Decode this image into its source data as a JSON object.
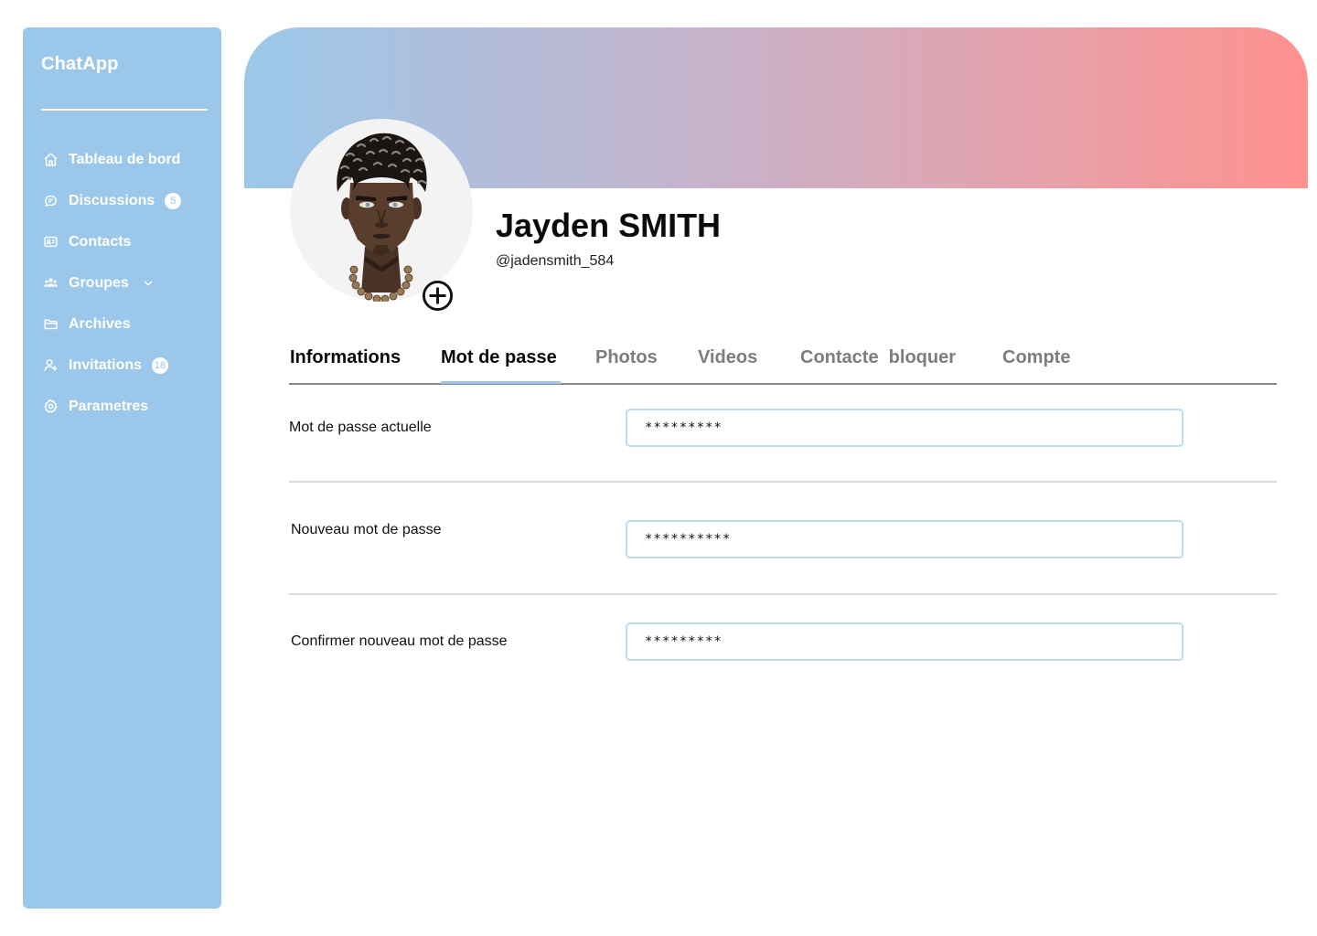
{
  "sidebar": {
    "brand": "ChatApp",
    "items": [
      {
        "label": "Tableau de bord",
        "icon": "home-icon"
      },
      {
        "label": "Discussions",
        "icon": "chat-bubble-icon",
        "badge": "5"
      },
      {
        "label": "Contacts",
        "icon": "contact-card-icon"
      },
      {
        "label": "Groupes",
        "icon": "group-icon",
        "has_dropdown": true
      },
      {
        "label": "Archives",
        "icon": "folder-icon"
      },
      {
        "label": "Invitations",
        "icon": "user-add-icon",
        "badge": "18"
      },
      {
        "label": "Parametres",
        "icon": "gear-icon"
      }
    ]
  },
  "profile": {
    "name": "Jayden SMITH",
    "handle": "@jadensmith_584"
  },
  "tabs": [
    {
      "label": "Informations"
    },
    {
      "label": "Mot de passe",
      "active": true
    },
    {
      "label": "Photos"
    },
    {
      "label": "Videos"
    },
    {
      "label": "Contacte  bloquer"
    },
    {
      "label": "Compte"
    }
  ],
  "form": {
    "current_password": {
      "label": "Mot de passe actuelle",
      "value": "*********"
    },
    "new_password": {
      "label": "Nouveau mot de passe",
      "value": "**********"
    },
    "confirm_password": {
      "label": "Confirmer nouveau mot de passe",
      "value": "*********"
    }
  },
  "colors": {
    "sidebar": "#9BC8EA",
    "banner_start": "#9BC8EA",
    "banner_end": "#FF928F",
    "active_tab_underline": "#9BC8EA"
  }
}
